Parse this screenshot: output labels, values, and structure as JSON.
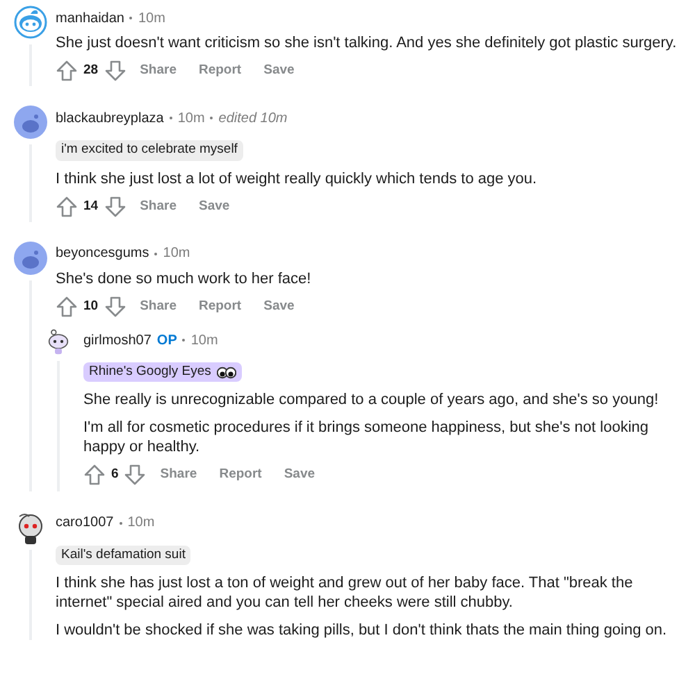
{
  "comments": [
    {
      "author": "manhaidan",
      "time": "10m",
      "avatar": {
        "kind": "snoo"
      },
      "paragraphs": [
        "She just doesn't want criticism so she isn't talking. And yes she definitely got plastic surgery."
      ],
      "score": "28",
      "actions": [
        "Share",
        "Report",
        "Save"
      ]
    },
    {
      "author": "blackaubreyplaza",
      "time": "10m",
      "edited": "edited 10m",
      "avatar": {
        "kind": "default"
      },
      "flair": {
        "text": "i'm excited to celebrate myself",
        "color": "#ededed"
      },
      "paragraphs": [
        "I think she just lost a lot of weight really quickly which tends to age you."
      ],
      "score": "14",
      "actions": [
        "Share",
        "Save"
      ]
    },
    {
      "author": "beyoncesgums",
      "time": "10m",
      "avatar": {
        "kind": "default"
      },
      "paragraphs": [
        "She's done so much work to her face!"
      ],
      "score": "10",
      "actions": [
        "Share",
        "Report",
        "Save"
      ],
      "children": [
        {
          "author": "girlmosh07",
          "op": "OP",
          "time": "10m",
          "avatar": {
            "kind": "purple"
          },
          "flair": {
            "text": "Rhine's Googly Eyes",
            "color": "#d9ccff",
            "kind": "eyes"
          },
          "paragraphs": [
            "She really is unrecognizable compared to a couple of years ago, and she's so young!",
            "I'm all for cosmetic procedures if it brings someone happiness, but she's not looking happy or healthy."
          ],
          "score": "6",
          "actions": [
            "Share",
            "Report",
            "Save"
          ]
        }
      ]
    },
    {
      "author": "caro1007",
      "time": "10m",
      "avatar": {
        "kind": "robot"
      },
      "flair": {
        "text": "Kail's defamation suit",
        "color": "#ededed"
      },
      "paragraphs": [
        "I think she has just lost a ton of weight and grew out of her baby face. That \"break the internet\" special aired and you can tell her cheeks were still chubby.",
        "I wouldn't be shocked if she was taking pills, but I don't think thats the main thing going on."
      ]
    }
  ]
}
